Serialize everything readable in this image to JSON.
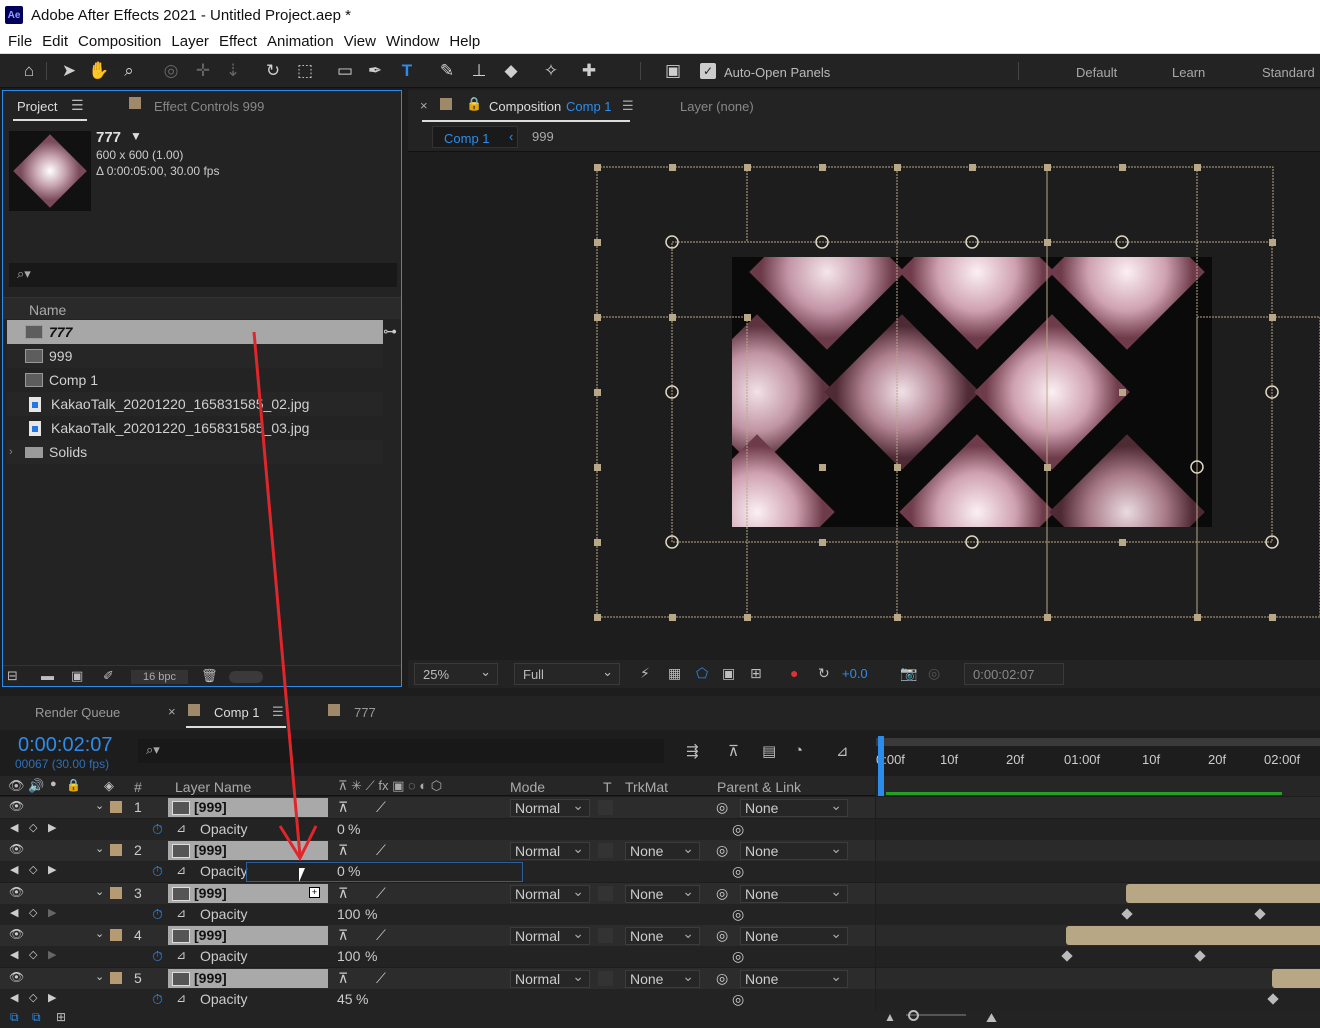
{
  "app": {
    "logo": "Ae",
    "title": "Adobe After Effects 2021 - Untitled Project.aep *"
  },
  "menu": [
    "File",
    "Edit",
    "Composition",
    "Layer",
    "Effect",
    "Animation",
    "View",
    "Window",
    "Help"
  ],
  "toolbar": {
    "auto_open": "Auto-Open Panels",
    "workspaces": [
      "Default",
      "Learn",
      "Standard"
    ]
  },
  "project": {
    "tab": "Project",
    "effect_tab": "Effect Controls 999",
    "item_name": "777",
    "dims": "600 x 600 (1.00)",
    "duration": "Δ 0:00:05:00, 30.00 fps",
    "col_name": "Name",
    "items": [
      {
        "name": "777",
        "type": "comp"
      },
      {
        "name": "999",
        "type": "comp"
      },
      {
        "name": "Comp 1",
        "type": "comp"
      },
      {
        "name": "KakaoTalk_20201220_165831585_02.jpg",
        "type": "image"
      },
      {
        "name": "KakaoTalk_20201220_165831585_03.jpg",
        "type": "image"
      },
      {
        "name": "Solids",
        "type": "folder"
      }
    ],
    "bpc": "16 bpc"
  },
  "comp_panel": {
    "tab_label": "Composition",
    "tab_comp": "Comp 1",
    "layer_tab": "Layer (none)",
    "breadcrumb_active": "Comp 1",
    "breadcrumb_other": "999",
    "zoom": "25%",
    "resolution": "Full",
    "exposure": "+0.0",
    "timecode": "0:00:02:07"
  },
  "timeline": {
    "render_queue": "Render Queue",
    "comp_tab": "Comp 1",
    "other_tab": "777",
    "timecode": "0:00:02:07",
    "frame_info": "00067 (30.00 fps)",
    "headers": {
      "num": "#",
      "layer_name": "Layer Name",
      "mode": "Mode",
      "t": "T",
      "trkmat": "TrkMat",
      "parent": "Parent & Link"
    },
    "ruler": [
      "0:00f",
      "10f",
      "20f",
      "01:00f",
      "10f",
      "20f",
      "02:00f"
    ],
    "layers": [
      {
        "num": "1",
        "name": "[999]",
        "mode": "Normal",
        "trkmat": "",
        "parent": "None",
        "prop": "Opacity",
        "value": "0",
        "unit": "%"
      },
      {
        "num": "2",
        "name": "[999]",
        "mode": "Normal",
        "trkmat": "None",
        "parent": "None",
        "prop": "Opacity",
        "value": "0",
        "unit": "%"
      },
      {
        "num": "3",
        "name": "[999]",
        "mode": "Normal",
        "trkmat": "None",
        "parent": "None",
        "prop": "Opacity",
        "value": "100",
        "unit": "%"
      },
      {
        "num": "4",
        "name": "[999]",
        "mode": "Normal",
        "trkmat": "None",
        "parent": "None",
        "prop": "Opacity",
        "value": "100",
        "unit": "%"
      },
      {
        "num": "5",
        "name": "[999]",
        "mode": "Normal",
        "trkmat": "None",
        "parent": "None",
        "prop": "Opacity",
        "value": "45",
        "unit": "%"
      }
    ]
  },
  "colors": {
    "accent": "#2d8ceb",
    "annotation": "#e0262a",
    "layer_label": "#b59a72",
    "clip": "#b7a784"
  }
}
